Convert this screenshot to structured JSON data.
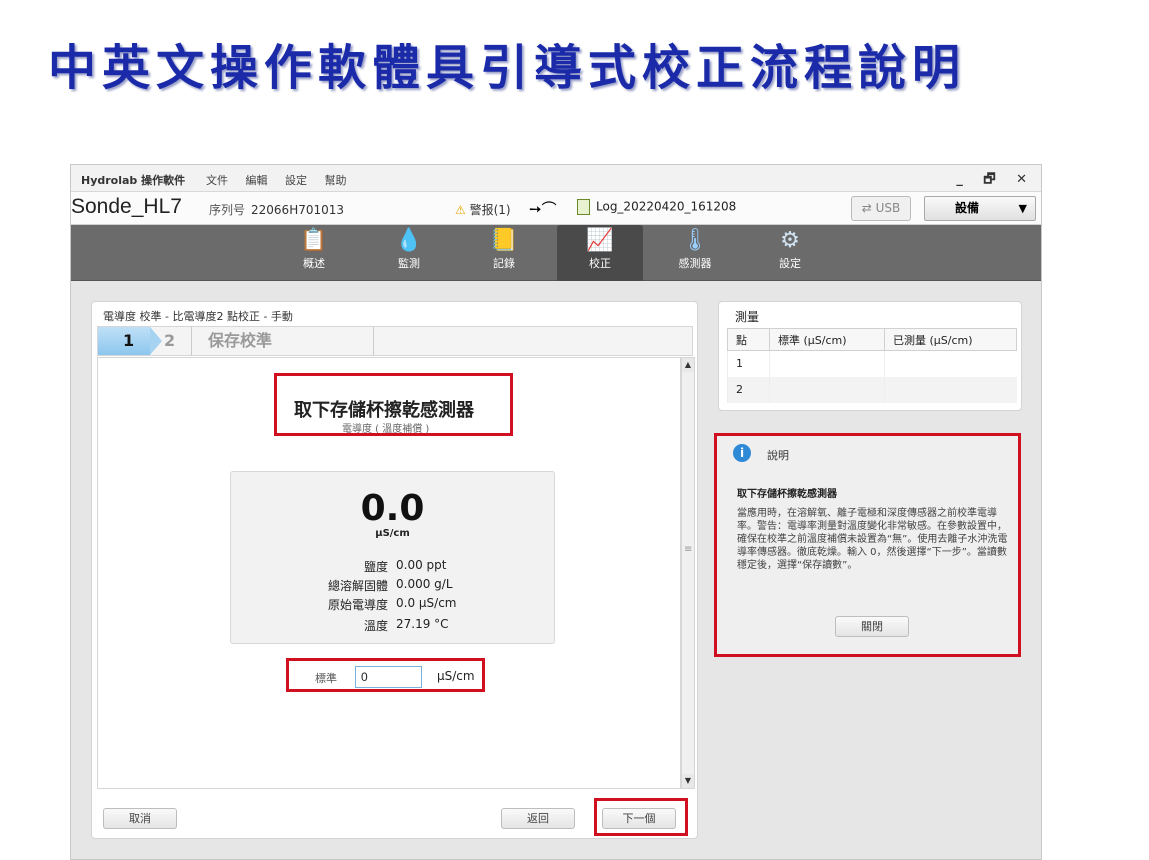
{
  "slide_title": "中英文操作軟體具引導式校正流程說明",
  "app": {
    "name": "Hydrolab 操作軟件",
    "menus": [
      "文件",
      "編輯",
      "設定",
      "幫助"
    ],
    "window_controls": [
      "_",
      "🗗",
      "✕"
    ]
  },
  "device": {
    "name": "Sonde_HL7",
    "serial_label": "序列号",
    "serial_value": "22066H701013",
    "alarm": "警报(1)",
    "log": "Log_20220420_161208",
    "usb": "USB",
    "dropdown": "設備"
  },
  "toolbar": {
    "items": [
      {
        "label": "概述",
        "icon": "clipboard-icon"
      },
      {
        "label": "監測",
        "icon": "drop-icon"
      },
      {
        "label": "記錄",
        "icon": "notebook-icon"
      },
      {
        "label": "校正",
        "icon": "calibrate-icon"
      },
      {
        "label": "感測器",
        "icon": "thermometer-icon"
      },
      {
        "label": "設定",
        "icon": "gear-icon"
      }
    ],
    "active": "校正"
  },
  "calibration": {
    "header": "電導度 校準  - 比電導度2 點校正 - 手動",
    "steps": [
      "1",
      "2",
      "保存校準"
    ],
    "instruction_title": "取下存儲杯擦乾感測器",
    "instruction_sub": "電導度 ( 溫度補償 )",
    "reading_value": "0.0",
    "reading_unit": "μS/cm",
    "params": [
      {
        "label": "鹽度",
        "value": "0.00 ppt"
      },
      {
        "label": "總溶解固體",
        "value": "0.000 g/L"
      },
      {
        "label": "原始電導度",
        "value": "0.0 μS/cm"
      },
      {
        "label": "溫度",
        "value": "27.19 °C"
      }
    ],
    "standard_label": "標準",
    "standard_value": "0",
    "standard_unit": "μS/cm",
    "cancel": "取消",
    "back": "返回",
    "next": "下一個"
  },
  "measurement": {
    "title": "測量",
    "columns": [
      "點",
      "標準  (μS/cm)",
      "已測量 (μS/cm)"
    ],
    "rows": [
      [
        "1",
        "",
        ""
      ],
      [
        "2",
        "",
        ""
      ]
    ]
  },
  "help": {
    "heading": "說明",
    "title": "取下存儲杯擦乾感測器",
    "text": "當應用時，在溶解氧、離子電極和深度傳感器之前校準電導率。警告：電導率測量對溫度變化非常敏感。在參數設置中，確保在校準之前溫度補償未設置為“無”。使用去離子水沖洗電導率傳感器。徹底乾燥。輸入 0，然後選擇“下一步”。當讀數穩定後，選擇“保存讀數”。",
    "close": "關閉"
  },
  "colors": {
    "title": "#1a2aa8",
    "highlight_box": "#d01020",
    "toolbar": "#6b6b6b",
    "step_active": "#8dc6ee"
  }
}
